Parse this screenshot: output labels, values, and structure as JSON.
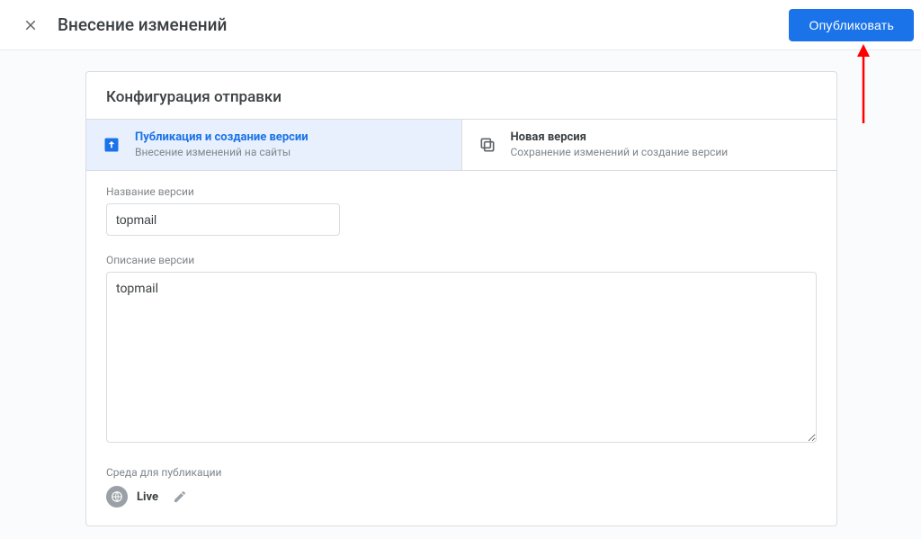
{
  "header": {
    "title": "Внесение изменений",
    "publish_label": "Опубликовать"
  },
  "card": {
    "title": "Конфигурация отправки",
    "tabs": [
      {
        "heading": "Публикация и создание версии",
        "sub": "Внесение изменений на сайты"
      },
      {
        "heading": "Новая версия",
        "sub": "Сохранение изменений и создание версии"
      }
    ],
    "version_name": {
      "label": "Название версии",
      "value": "topmail"
    },
    "version_desc": {
      "label": "Описание версии",
      "value": "topmail"
    },
    "env": {
      "label": "Среда для публикации",
      "value": "Live"
    }
  }
}
